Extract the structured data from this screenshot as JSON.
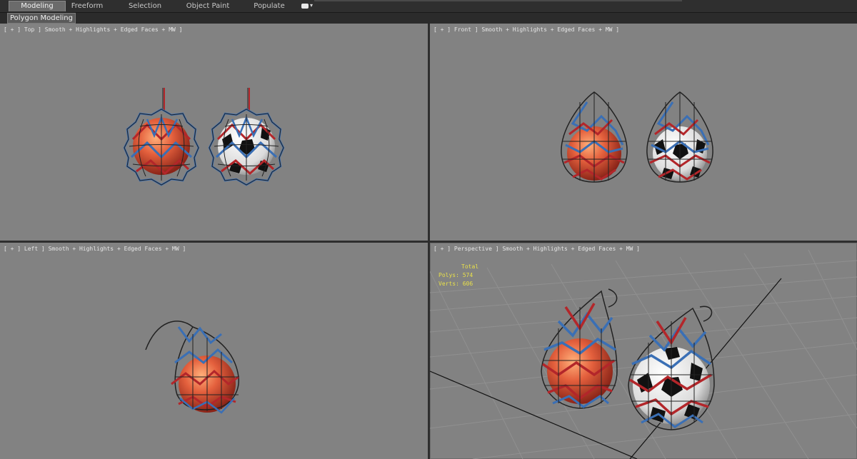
{
  "ribbon": {
    "tabs": [
      {
        "label": "Modeling",
        "active": true
      },
      {
        "label": "Freeform",
        "active": false
      },
      {
        "label": "Selection",
        "active": false
      },
      {
        "label": "Object Paint",
        "active": false
      },
      {
        "label": "Populate",
        "active": false
      }
    ],
    "panel_label": "Polygon Modeling"
  },
  "viewports": {
    "top": {
      "label": "[ + ] Top ] Smooth + Highlights + Edged Faces + MW ]"
    },
    "front": {
      "label": "[ + ] Front ] Smooth + Highlights + Edged Faces + MW ]"
    },
    "left": {
      "label": "[ + ] Left ] Smooth + Highlights + Edged Faces + MW ]"
    },
    "perspective": {
      "label": "[ + ] Perspective ] Smooth + Highlights + Edged Faces + MW ]",
      "stats": {
        "header": "Total",
        "polys": "Polys: 574",
        "verts": "Verts: 606"
      }
    }
  },
  "colors": {
    "viewport_bg": "#828282",
    "net_red": "#b3262a",
    "net_blue": "#3a6fb5",
    "ball_orange": "#d9553a",
    "stats_yellow": "#e8e04a"
  },
  "icons": {
    "viewport_extra": "camera-dropdown-icon"
  }
}
